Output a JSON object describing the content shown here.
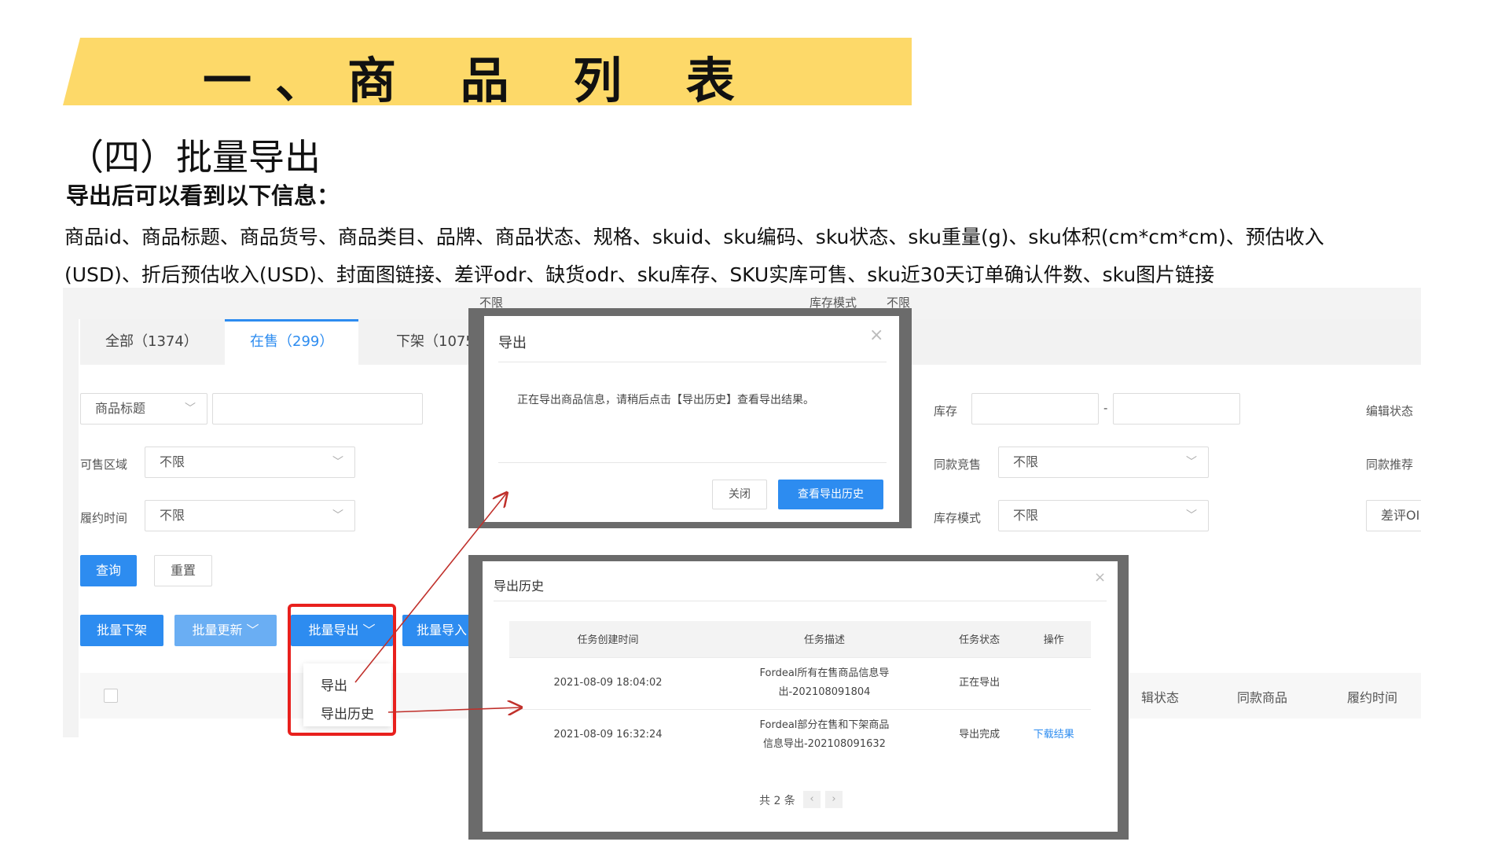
{
  "slide": {
    "title": "一、商 品 列 表",
    "subtitle": "（四）批量导出",
    "subtitle2": "导出后可以看到以下信息：",
    "desc_line1": "商品id、商品标题、商品货号、商品类目、品牌、商品状态、规格、skuid、sku编码、sku状态、sku重量(g)、sku体积(cm*cm*cm)、预估收入",
    "desc_line2": "(USD)、折后预估收入(USD)、封面图链接、差评odr、缺货odr、sku库存、SKU实库可售、sku近30天订单确认件数、sku图片链接"
  },
  "tabs": [
    {
      "label": "全部（1374）"
    },
    {
      "label": "在售（299）"
    },
    {
      "label": "下架（1075）"
    }
  ],
  "filters": {
    "title_select": "商品标题",
    "sale_region_label": "可售区域",
    "sale_region_value": "不限",
    "fulfill_time_label": "履约时间",
    "fulfill_time_value": "不限",
    "stock_label": "库存",
    "stock_dash": "-",
    "same_compete_label": "同款竞售",
    "same_compete_value": "不限",
    "stock_mode_label": "库存模式",
    "stock_mode_value": "不限",
    "edit_status_label": "编辑状态",
    "same_recommend_label": "同款推荐",
    "bad_review_value": "差评OI",
    "top_value1": "不限",
    "top_label2": "库存模式",
    "top_value2": "不限"
  },
  "buttons": {
    "query": "查询",
    "reset": "重置",
    "batch_offline": "批量下架",
    "batch_update": "批量更新",
    "batch_export": "批量导出",
    "batch_import": "批量导入"
  },
  "export_menu": {
    "export": "导出",
    "export_history": "导出历史"
  },
  "table_head": {
    "edit_status": "辑状态",
    "same_goods": "同款商品",
    "fulfill_time": "履约时间"
  },
  "export_dialog": {
    "title": "导出",
    "message": "正在导出商品信息，请稍后点击【导出历史】查看导出结果。",
    "close_btn": "关闭",
    "view_history_btn": "查看导出历史"
  },
  "history_dialog": {
    "title": "导出历史",
    "columns": [
      "任务创建时间",
      "任务描述",
      "任务状态",
      "操作"
    ],
    "rows": [
      {
        "time": "2021-08-09 18:04:02",
        "desc1": "Fordeal所有在售商品信息导",
        "desc2": "出-202108091804",
        "status": "正在导出",
        "action": ""
      },
      {
        "time": "2021-08-09 16:32:24",
        "desc1": "Fordeal部分在售和下架商品",
        "desc2": "信息导出-202108091632",
        "status": "导出完成",
        "action": "下载结果"
      }
    ],
    "total": "共 2 条"
  },
  "colors": {
    "accent": "#2d8cf0",
    "banner": "#fdd969",
    "highlight": "#e8201d"
  }
}
